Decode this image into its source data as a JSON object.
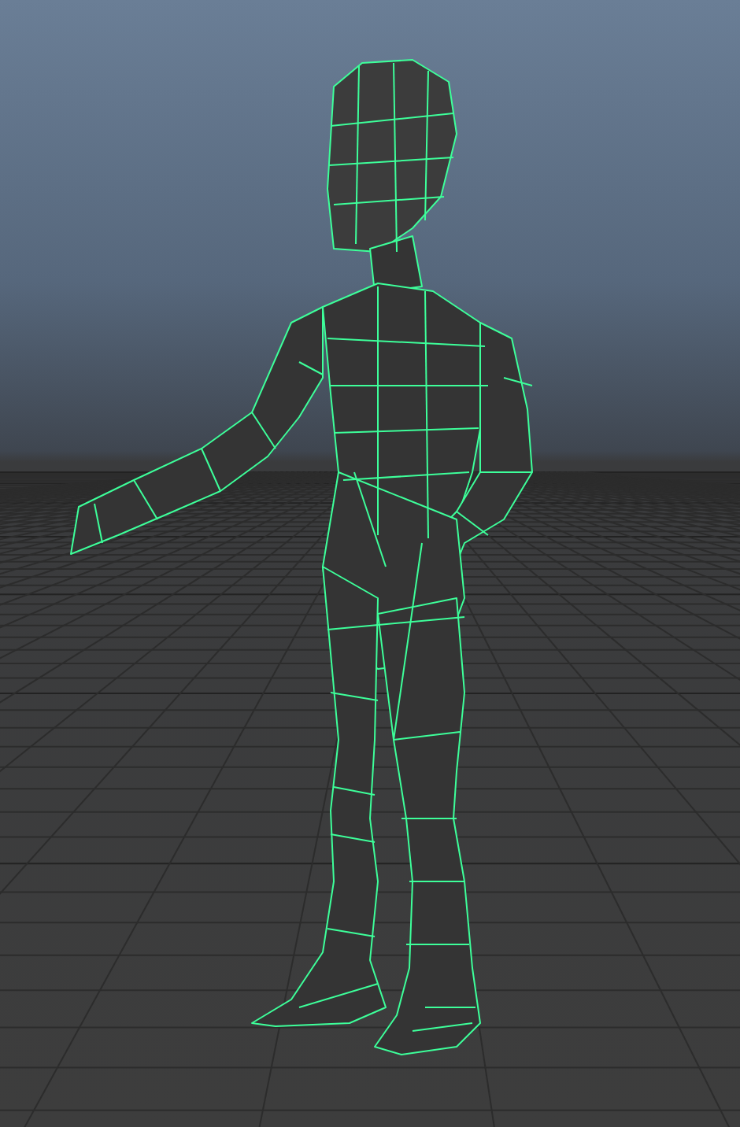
{
  "viewport": {
    "grid_visible": true,
    "wireframe_on_shaded": true
  }
}
